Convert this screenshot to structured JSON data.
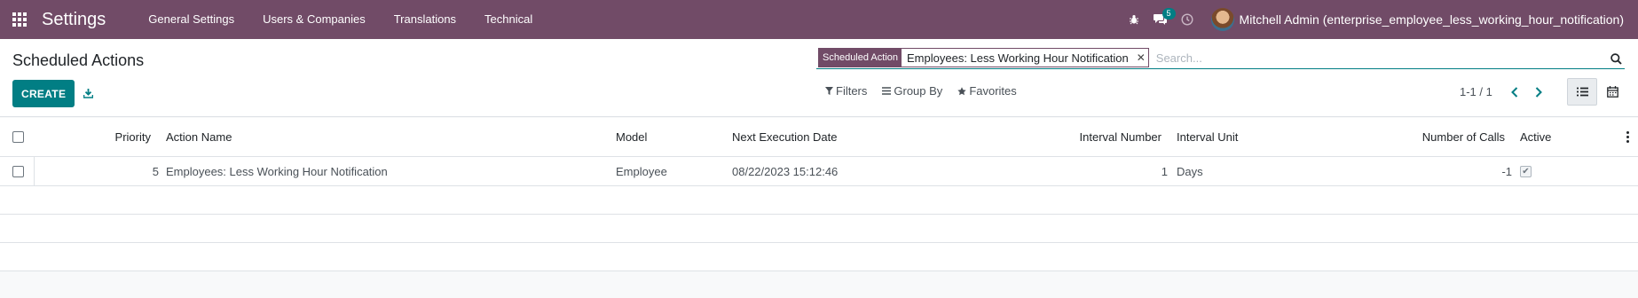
{
  "navbar": {
    "app_title": "Settings",
    "menu": [
      "General Settings",
      "Users & Companies",
      "Translations",
      "Technical"
    ],
    "messages_count": "5",
    "user_name": "Mitchell Admin (enterprise_employee_less_working_hour_notification)",
    "bg_color": "#714b67"
  },
  "control_panel": {
    "breadcrumb": "Scheduled Actions",
    "create_label": "CREATE",
    "search": {
      "facet_label": "Scheduled Action",
      "facet_value": "Employees: Less Working Hour Notification",
      "placeholder": "Search..."
    },
    "filters_label": "Filters",
    "group_by_label": "Group By",
    "favorites_label": "Favorites",
    "pager": "1-1 / 1",
    "accent_color": "#017e84"
  },
  "table": {
    "columns": {
      "priority": "Priority",
      "action_name": "Action Name",
      "model": "Model",
      "next_execution": "Next Execution Date",
      "interval_number": "Interval Number",
      "interval_unit": "Interval Unit",
      "number_of_calls": "Number of Calls",
      "active": "Active"
    },
    "rows": [
      {
        "priority": "5",
        "action_name": "Employees: Less Working Hour Notification",
        "model": "Employee",
        "next_execution": "08/22/2023 15:12:46",
        "interval_number": "1",
        "interval_unit": "Days",
        "number_of_calls": "-1",
        "active": true
      }
    ]
  }
}
